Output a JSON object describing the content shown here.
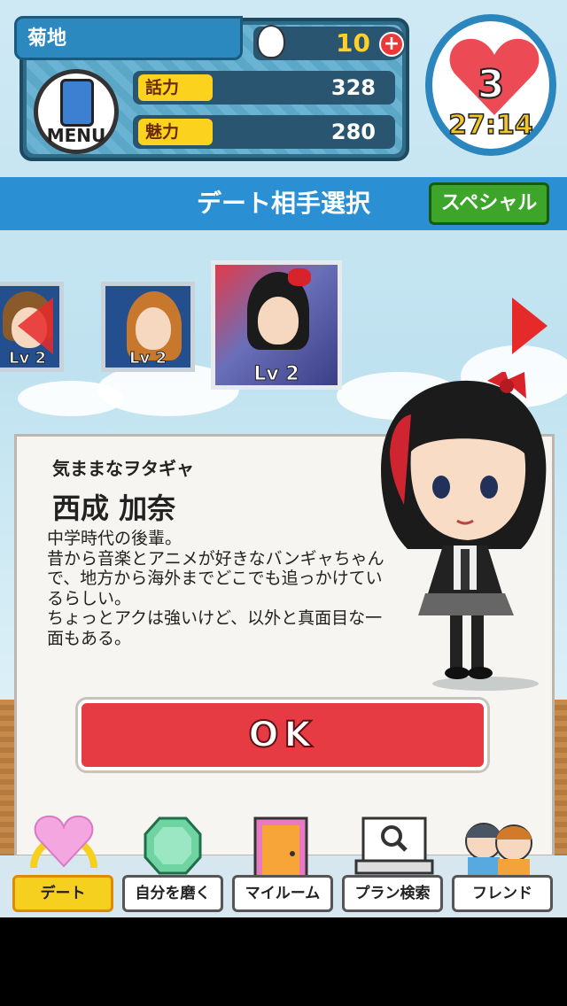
{
  "player": {
    "name": "菊地",
    "eggs": "10",
    "stats": [
      {
        "label": "話力",
        "value": "328"
      },
      {
        "label": "魅力",
        "value": "280"
      }
    ],
    "menu_label": "MENU",
    "lives": "3",
    "timer": "27:14"
  },
  "header": {
    "title": "デート相手選択",
    "special_label": "スペシャル"
  },
  "carousel": [
    {
      "level": "Lv 2",
      "hair_color": "#8b5a2b"
    },
    {
      "level": "Lv 2",
      "hair_color": "#c7782c"
    },
    {
      "level": "Lv 2",
      "hair_color": "#1b1b1b"
    }
  ],
  "profile": {
    "subtitle": "気ままなヲタギャ",
    "name": "西成 加奈",
    "description": "中学時代の後輩。\n昔から音楽とアニメが好きなバンギャちゃんで、地方から海外までどこでも追っかけているらしい。\nちょっとアクは強いけど、以外と真面目な一面もある。",
    "ok_label": "OK"
  },
  "nav": [
    {
      "label": "デート",
      "icon": "heart-icon",
      "active": true
    },
    {
      "label": "自分を磨く",
      "icon": "gem-icon",
      "active": false
    },
    {
      "label": "マイルーム",
      "icon": "door-icon",
      "active": false
    },
    {
      "label": "プラン検索",
      "icon": "laptop-search-icon",
      "active": false
    },
    {
      "label": "フレンド",
      "icon": "friends-icon",
      "active": false
    }
  ],
  "colors": {
    "accent_blue": "#2b8fd3",
    "ok_red": "#e73b43",
    "special_green": "#3ca52a",
    "stat_yellow": "#fbd31f"
  }
}
